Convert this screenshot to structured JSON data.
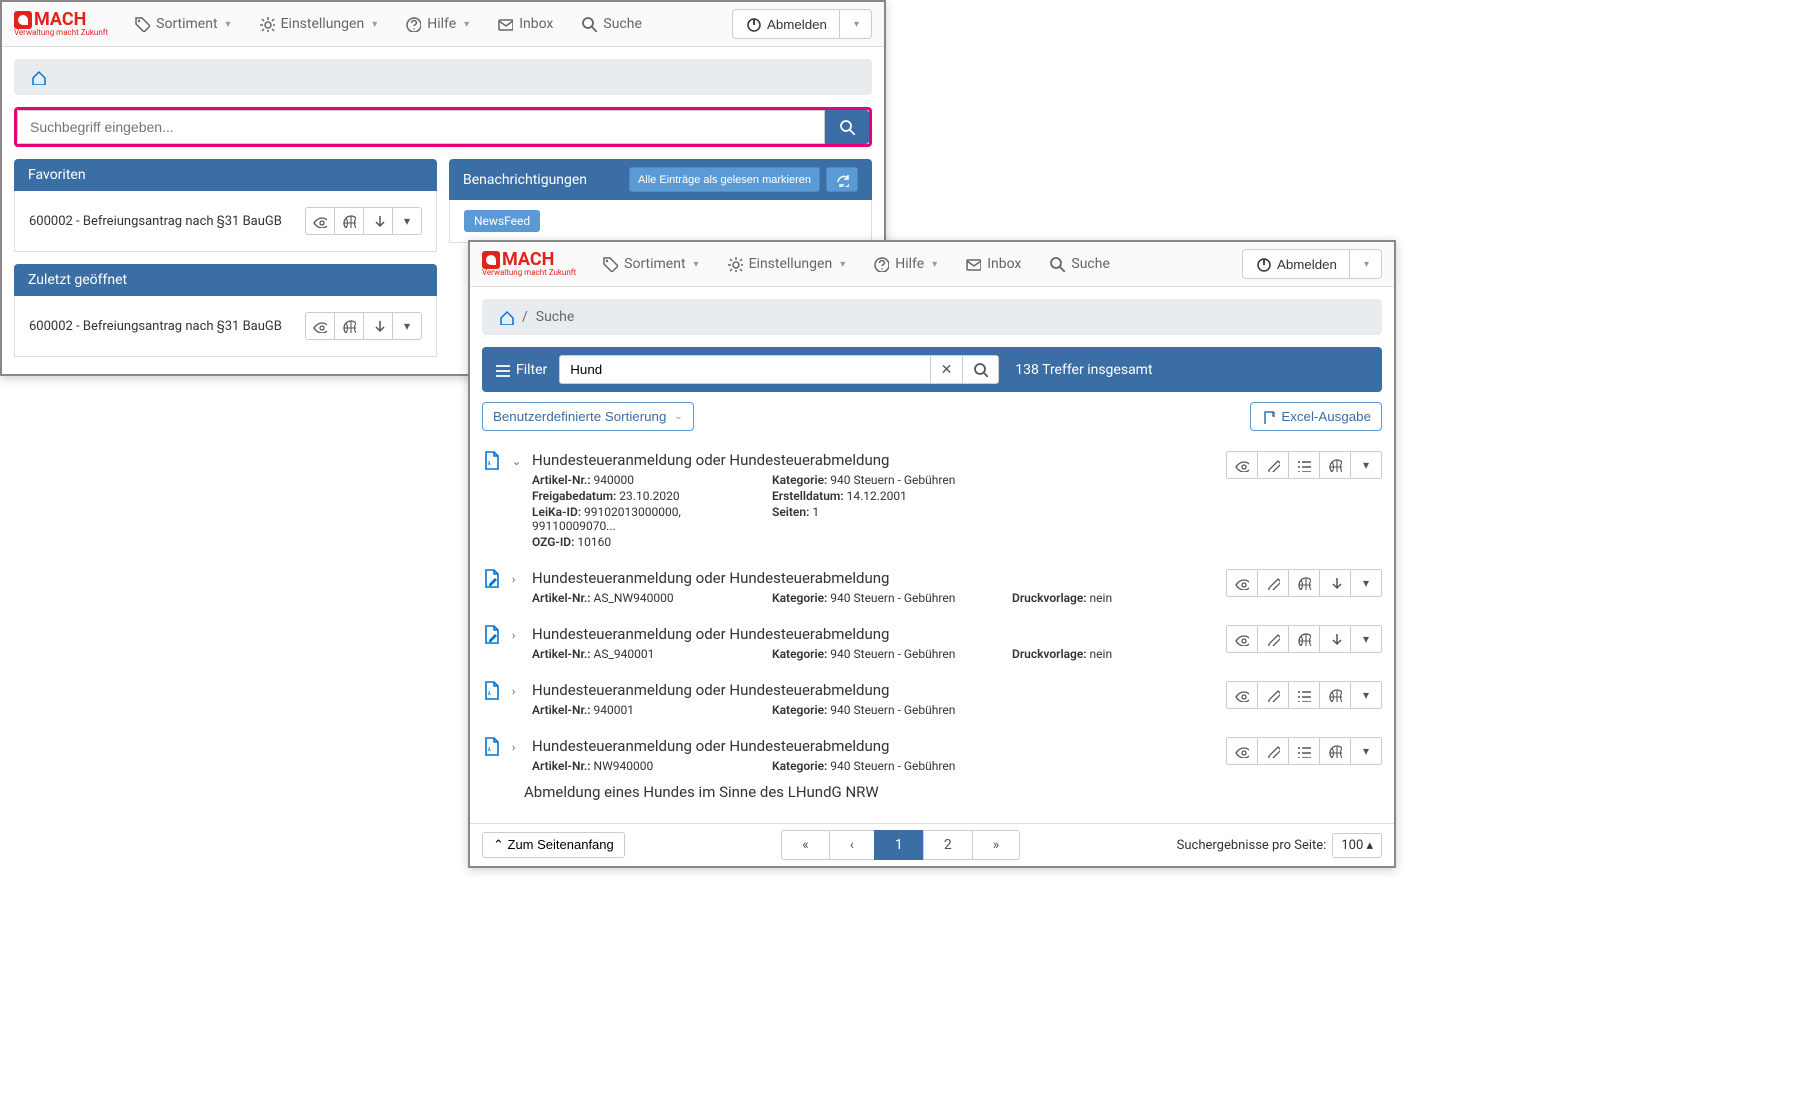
{
  "logo": {
    "brand": "MACH",
    "tagline": "Verwaltung macht Zukunft"
  },
  "nav": {
    "sortiment": "Sortiment",
    "einstellungen": "Einstellungen",
    "hilfe": "Hilfe",
    "inbox": "Inbox",
    "suche": "Suche",
    "abmelden": "Abmelden"
  },
  "back": {
    "search_placeholder": "Suchbegriff eingeben...",
    "favoriten": {
      "title": "Favoriten",
      "item": "600002 - Befreiungsantrag nach §31 BauGB"
    },
    "benachrichtigungen": {
      "title": "Benachrichtigungen",
      "mark_all": "Alle Einträge als gelesen markieren",
      "newsfeed": "NewsFeed"
    },
    "zuletzt": {
      "title": "Zuletzt geöffnet",
      "item": "600002 - Befreiungsantrag nach §31 BauGB"
    }
  },
  "front": {
    "breadcrumb_suche": "Suche",
    "filter_label": "Filter",
    "search_value": "Hund",
    "hits": "138 Treffer insgesamt",
    "sort_label": "Benutzerdefinierte Sortierung",
    "excel_label": "Excel-Ausgabe",
    "labels": {
      "artikelnr": "Artikel-Nr.:",
      "kategorie": "Kategorie:",
      "freigabedatum": "Freigabedatum:",
      "erstelldatum": "Erstelldatum:",
      "leika": "LeiKa-ID:",
      "seiten": "Seiten:",
      "ozg": "OZG-ID:",
      "druckvorlage": "Druckvorlage:"
    },
    "results": [
      {
        "title": "Hundesteueranmeldung oder Hundesteuerabmeldung",
        "artikelnr": "940000",
        "kategorie": "940 Steuern - Gebühren",
        "freigabedatum": "23.10.2020",
        "erstelldatum": "14.12.2001",
        "leika": "99102013000000, 99110009070...",
        "seiten": "1",
        "ozg": "10160",
        "expanded": true,
        "doctype": "pdf",
        "actions": [
          "eye",
          "pencil",
          "list",
          "globe",
          "caret"
        ]
      },
      {
        "title": "Hundesteueranmeldung oder Hundesteuerabmeldung",
        "artikelnr": "AS_NW940000",
        "kategorie": "940 Steuern - Gebühren",
        "druckvorlage": "nein",
        "expanded": false,
        "doctype": "pdf-edit",
        "actions": [
          "eye",
          "pencil",
          "globe",
          "download",
          "caret"
        ]
      },
      {
        "title": "Hundesteueranmeldung oder Hundesteuerabmeldung",
        "artikelnr": "AS_940001",
        "kategorie": "940 Steuern - Gebühren",
        "druckvorlage": "nein",
        "expanded": false,
        "doctype": "pdf-edit",
        "actions": [
          "eye",
          "pencil",
          "globe",
          "download",
          "caret"
        ]
      },
      {
        "title": "Hundesteueranmeldung oder Hundesteuerabmeldung",
        "artikelnr": "940001",
        "kategorie": "940 Steuern - Gebühren",
        "expanded": false,
        "doctype": "pdf",
        "actions": [
          "eye",
          "pencil",
          "list",
          "globe",
          "caret"
        ]
      },
      {
        "title": "Hundesteueranmeldung oder Hundesteuerabmeldung",
        "artikelnr": "NW940000",
        "kategorie": "940 Steuern - Gebühren",
        "expanded": false,
        "doctype": "pdf",
        "actions": [
          "eye",
          "pencil",
          "list",
          "globe",
          "caret"
        ]
      }
    ],
    "cut_title": "Abmeldung eines Hundes im Sinne des LHundG NRW",
    "footer": {
      "to_top": "Zum Seitenanfang",
      "pages": [
        "«",
        "‹",
        "1",
        "2",
        "»"
      ],
      "active_page": "1",
      "per_page_label": "Suchergebnisse pro Seite:",
      "per_page_value": "100"
    }
  }
}
